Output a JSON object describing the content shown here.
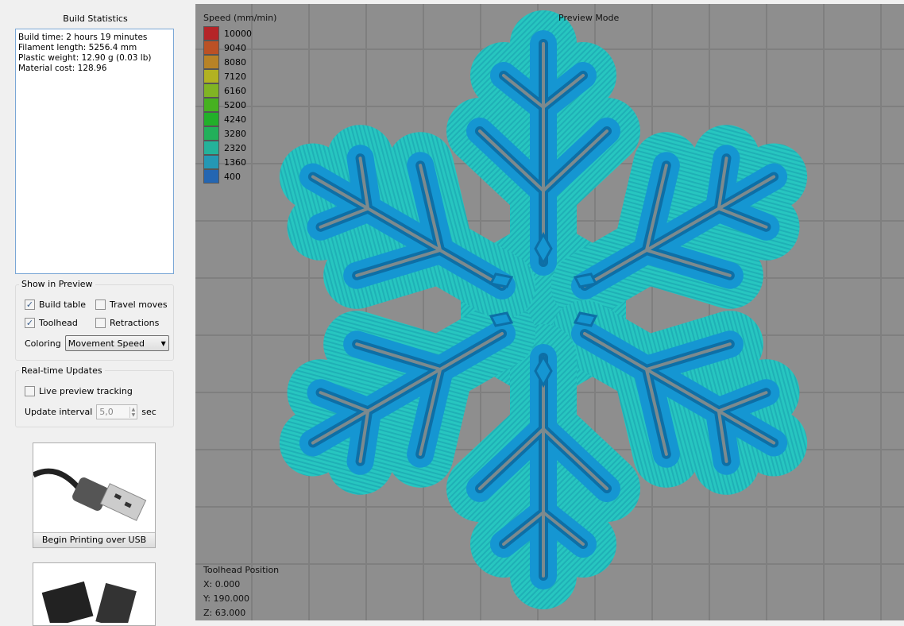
{
  "build_statistics": {
    "title": "Build Statistics",
    "lines": [
      "Build time: 2 hours 19 minutes",
      "Filament length: 5256.4 mm",
      "Plastic weight: 12.90 g (0.03 lb)",
      "Material cost: 128.96"
    ]
  },
  "show_in_preview": {
    "title": "Show in Preview",
    "build_table": "Build table",
    "build_table_checked": true,
    "travel_moves": "Travel moves",
    "travel_moves_checked": false,
    "toolhead": "Toolhead",
    "toolhead_checked": true,
    "retractions": "Retractions",
    "retractions_checked": false,
    "coloring_label": "Coloring",
    "coloring_value": "Movement Speed"
  },
  "realtime": {
    "title": "Real-time Updates",
    "live_tracking": "Live preview tracking",
    "live_tracking_checked": false,
    "interval_label": "Update interval",
    "interval_value": "5,0",
    "interval_unit": "sec"
  },
  "buttons": {
    "usb": "Begin Printing over USB"
  },
  "preview": {
    "mode": "Preview Mode",
    "legend_title": "Speed (mm/min)",
    "legend": [
      {
        "v": "10000",
        "c": "#b52428"
      },
      {
        "v": "9040",
        "c": "#bb5125"
      },
      {
        "v": "8080",
        "c": "#b88326"
      },
      {
        "v": "7120",
        "c": "#b2b222"
      },
      {
        "v": "6160",
        "c": "#80b424"
      },
      {
        "v": "5200",
        "c": "#46b220"
      },
      {
        "v": "4240",
        "c": "#22b02a"
      },
      {
        "v": "3280",
        "c": "#22b05a"
      },
      {
        "v": "2320",
        "c": "#24b29a"
      },
      {
        "v": "1360",
        "c": "#2498b4"
      },
      {
        "v": "400",
        "c": "#2466b2"
      }
    ],
    "toolhead_title": "Toolhead Position",
    "x": "X: 0.000",
    "y": "Y: 190.000",
    "z": "Z: 63.000"
  }
}
